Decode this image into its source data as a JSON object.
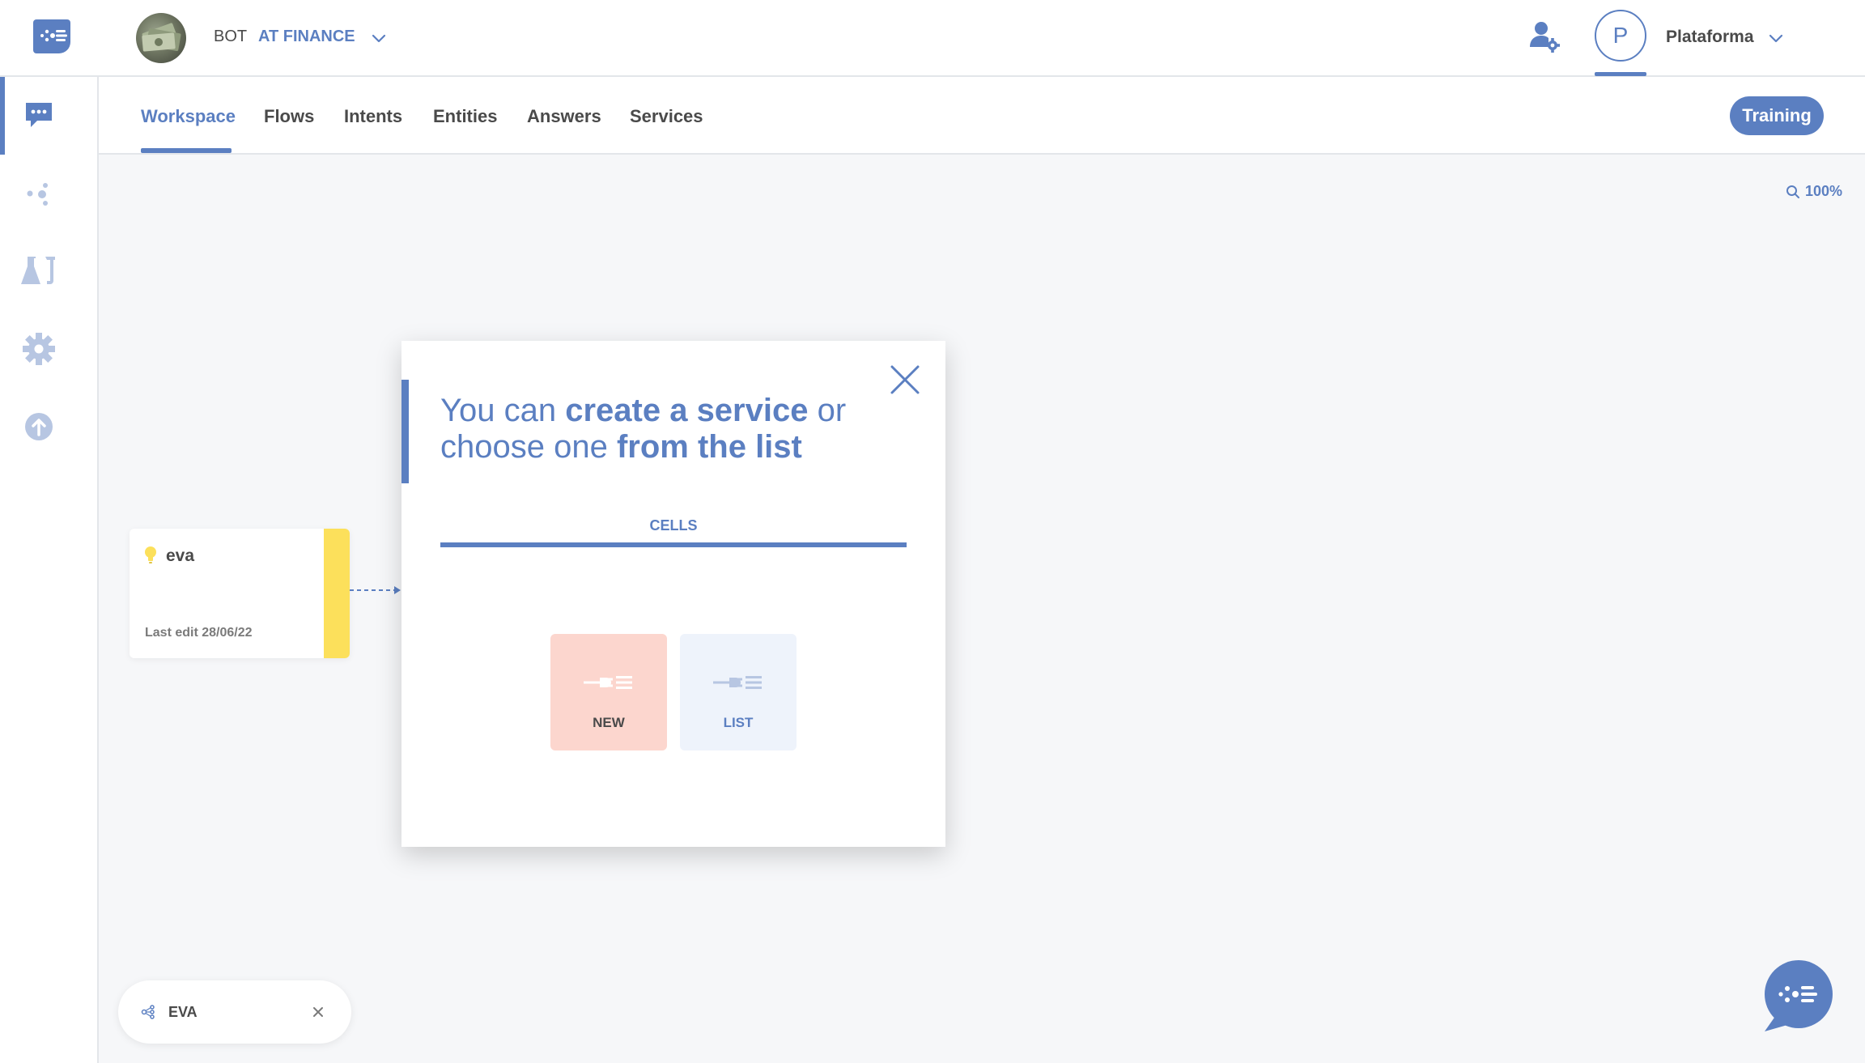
{
  "header": {
    "bot_prefix": "BOT",
    "bot_name": "AT FINANCE",
    "user_initial": "P",
    "org_name": "Plataforma"
  },
  "sidebar": {
    "items": [
      {
        "icon": "chat-bubble-icon",
        "active": true
      },
      {
        "icon": "nodes-icon"
      },
      {
        "icon": "lab-flask-icon"
      },
      {
        "icon": "gear-icon"
      },
      {
        "icon": "upload-icon"
      }
    ]
  },
  "tabs": [
    {
      "label": "Workspace",
      "active": true
    },
    {
      "label": "Flows"
    },
    {
      "label": "Intents"
    },
    {
      "label": "Entities"
    },
    {
      "label": "Answers"
    },
    {
      "label": "Services"
    }
  ],
  "training_label": "Training",
  "zoom": "100%",
  "node": {
    "title": "eva",
    "last_edit": "Last edit 28/06/22"
  },
  "modal": {
    "heading_part1": "You can ",
    "heading_bold1": "create a service",
    "heading_part2": " or choose one ",
    "heading_bold2": "from the list",
    "tab_label": "CELLS",
    "option_new_label": "NEW",
    "option_list_label": "LIST"
  },
  "flow_chip": {
    "label": "EVA"
  },
  "colors": {
    "accent": "#5b7fc1",
    "node_stripe": "#fce05b",
    "new_option_bg": "#fcd6ce",
    "list_option_bg": "#eef3fb"
  }
}
